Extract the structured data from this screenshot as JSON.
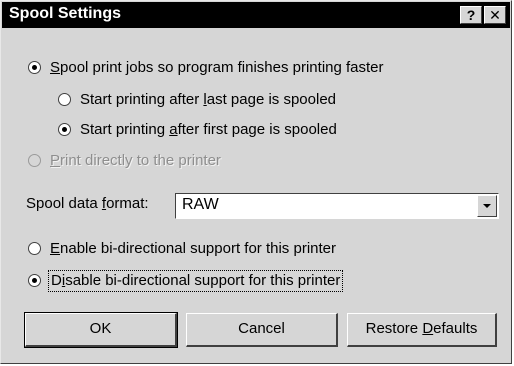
{
  "window": {
    "title": "Spool Settings",
    "help_glyph": "?",
    "close_glyph": "✕"
  },
  "spool": {
    "option_spool": {
      "pre": "",
      "key": "S",
      "post": "pool print jobs so program finishes printing faster",
      "checked": true
    },
    "option_after_last": {
      "pre": "Start printing after ",
      "key": "l",
      "post": "ast page is spooled",
      "checked": false
    },
    "option_after_first": {
      "pre": "Start printing ",
      "key": "a",
      "post": "fter first page is spooled",
      "checked": true
    },
    "option_direct": {
      "pre": "",
      "key": "P",
      "post": "rint directly to the printer",
      "checked": false,
      "disabled": true
    }
  },
  "format": {
    "label_pre": "Spool data ",
    "label_key": "f",
    "label_post": "ormat:",
    "value": "RAW"
  },
  "bidi": {
    "enable": {
      "pre": "",
      "key": "E",
      "post": "nable bi-directional support for this printer",
      "checked": false
    },
    "disable": {
      "pre": "D",
      "key": "i",
      "post": "sable bi-directional support for this printer",
      "checked": true
    }
  },
  "buttons": {
    "ok": "OK",
    "cancel": "Cancel",
    "restore_pre": "Restore ",
    "restore_key": "D",
    "restore_post": "efaults"
  }
}
